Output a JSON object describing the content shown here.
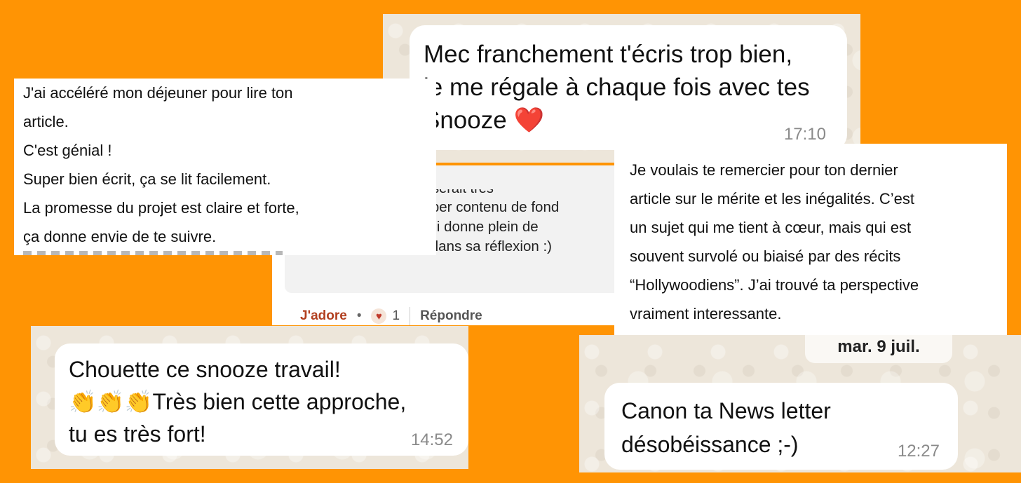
{
  "colors": {
    "background": "#FF9404",
    "whatsapp_bg": "#EDE6DA",
    "linkedin_like": "#B24020"
  },
  "whatsapp_top": {
    "lines": [
      "Mec franchement t'écris trop bien,",
      "je me régale à chaque fois avec tes",
      "Snooze"
    ],
    "emoji": "❤️",
    "time": "17:10"
  },
  "linkedin_comment": {
    "cut_line": "comme que snooze serait très",
    "lines": [
      "complémentaire, super contenu de fond",
      "et agréable à lire, qui donne plein de",
      "billes pour avancer dans sa réflexion :)"
    ],
    "like_label": "J'adore",
    "reaction_icon": "heart-icon",
    "reaction_count": "1",
    "reply_label": "Répondre"
  },
  "text_left": {
    "lines": [
      "J'ai accéléré mon déjeuner pour lire ton",
      "article.",
      "C'est génial !",
      "Super bien écrit, ça se lit facilement.",
      "La promesse du projet est claire et forte,",
      "ça donne envie de te suivre."
    ]
  },
  "text_right": {
    "lines": [
      "Je voulais te remercier pour ton dernier",
      "article sur le mérite et les inégalités. C’est",
      "un sujet qui me tient à cœur, mais qui est",
      "souvent survolé ou biaisé par des récits",
      "“Hollywoodiens”. J’ai trouvé ta perspective",
      "vraiment interessante."
    ]
  },
  "whatsapp_bottom_left": {
    "lines": [
      "Chouette ce snooze travail!",
      "Très bien cette approche,",
      "tu es très fort!"
    ],
    "emoji": "👏👏👏",
    "time": "14:52"
  },
  "whatsapp_bottom_right": {
    "date": "mar. 9 juil.",
    "lines": [
      "Canon ta News letter",
      "désobéissance ;-)"
    ],
    "time": "12:27"
  }
}
